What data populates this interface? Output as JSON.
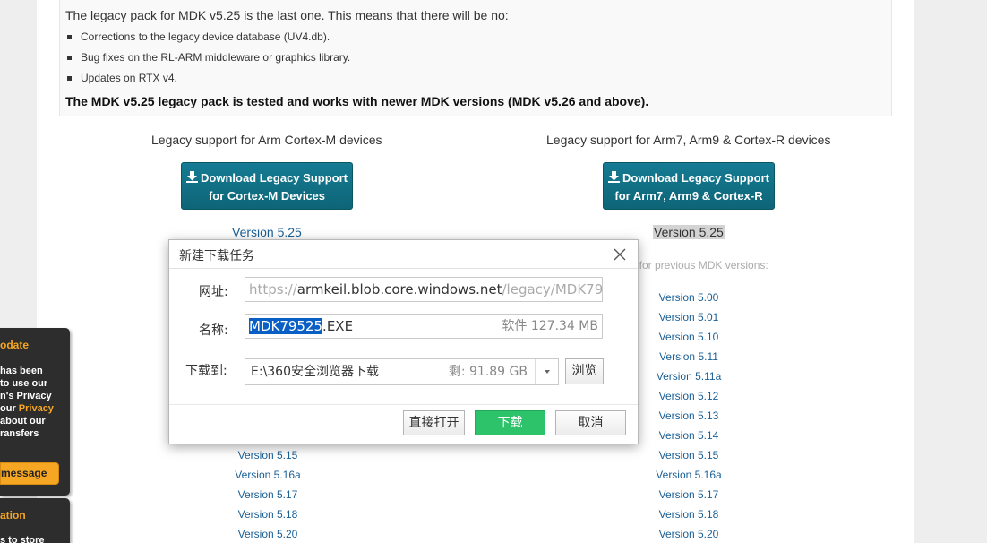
{
  "notice": {
    "lead": "The legacy pack for MDK v5.25 is the last one. This means that there will be no:",
    "items": [
      "Corrections to the legacy device database (UV4.db).",
      "Bug fixes on the RL-ARM middleware or graphics library.",
      "Updates on RTX v4."
    ],
    "bold": "The MDK v5.25 legacy pack is tested and works with newer MDK versions (MDK v5.26 and above)."
  },
  "left": {
    "title": "Legacy support for Arm Cortex-M devices",
    "button_line1": "Download Legacy Support",
    "button_line2": "for Cortex-M Devices",
    "version": "Version 5.25",
    "versions": [
      "Version 5.15",
      "Version 5.16a",
      "Version 5.17",
      "Version 5.18",
      "Version 5.20"
    ]
  },
  "right": {
    "title": "Legacy support for Arm7, Arm9 & Cortex-R devices",
    "button_line1": "Download Legacy Support",
    "button_line2": "for Arm7, Arm9 & Cortex-R",
    "version": "Version 5.25",
    "prev_label": "t for previous MDK versions:",
    "versions": [
      "Version 5.00",
      "Version 5.01",
      "Version 5.10",
      "Version 5.11",
      "Version 5.11a",
      "Version 5.12",
      "Version 5.13",
      "Version 5.14",
      "Version 5.15",
      "Version 5.16a",
      "Version 5.17",
      "Version 5.18",
      "Version 5.20"
    ]
  },
  "cookie1": {
    "title": "odate",
    "lines": [
      "has been",
      "to use our",
      "n's Privacy",
      "our ",
      "about our",
      "ransfers"
    ],
    "privacy_link": "Privacy",
    "button": "message"
  },
  "cookie2": {
    "title": "ation",
    "line": "s to store"
  },
  "dialog": {
    "title": "新建下载任务",
    "url_label": "网址:",
    "url_prefix": "https://",
    "url_host": "armkeil.blob.core.windows.net",
    "url_rest": "/legacy/MDK79",
    "name_label": "名称:",
    "name_selected": "MDK79525",
    "name_ext": ".EXE",
    "name_meta": "软件 127.34 MB",
    "dest_label": "下载到:",
    "dest_path": "E:\\360安全浏览器下载",
    "dest_free": "剩: 91.89 GB",
    "browse": "浏览",
    "open_direct": "直接打开",
    "download": "下载",
    "cancel": "取消"
  },
  "colors": {
    "accent_button": "#157b93",
    "link": "#1a5f95",
    "primary_green": "#2cc36b",
    "cookie_orange": "#f5a623"
  }
}
